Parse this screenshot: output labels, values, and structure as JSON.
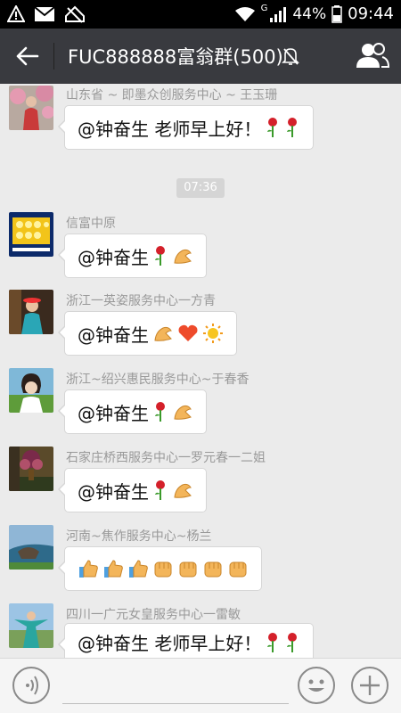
{
  "status_bar": {
    "battery": "44%",
    "time": "09:44",
    "network": "G"
  },
  "header": {
    "title": "FUC888888富翁群(500)"
  },
  "timestamp": "07:36",
  "messages": [
    {
      "sender": "山东省 ~ 即墨众创服务中心 ~ 王玉珊",
      "text": "@钟奋生 老师早上好！"
    },
    {
      "sender": "信富中原",
      "text": "@钟奋生"
    },
    {
      "sender": "浙江一英姿服务中心一方青",
      "text": "@钟奋生"
    },
    {
      "sender": "浙江~绍兴惠民服务中心~于春香",
      "text": "@钟奋生"
    },
    {
      "sender": "石家庄桥西服务中心一罗元春一二姐",
      "text": "@钟奋生"
    },
    {
      "sender": "河南~焦作服务中心~杨兰",
      "text": ""
    },
    {
      "sender": "四川一广元女皇服务中心一雷敏",
      "text": "@钟奋生 老师早上好！"
    }
  ]
}
